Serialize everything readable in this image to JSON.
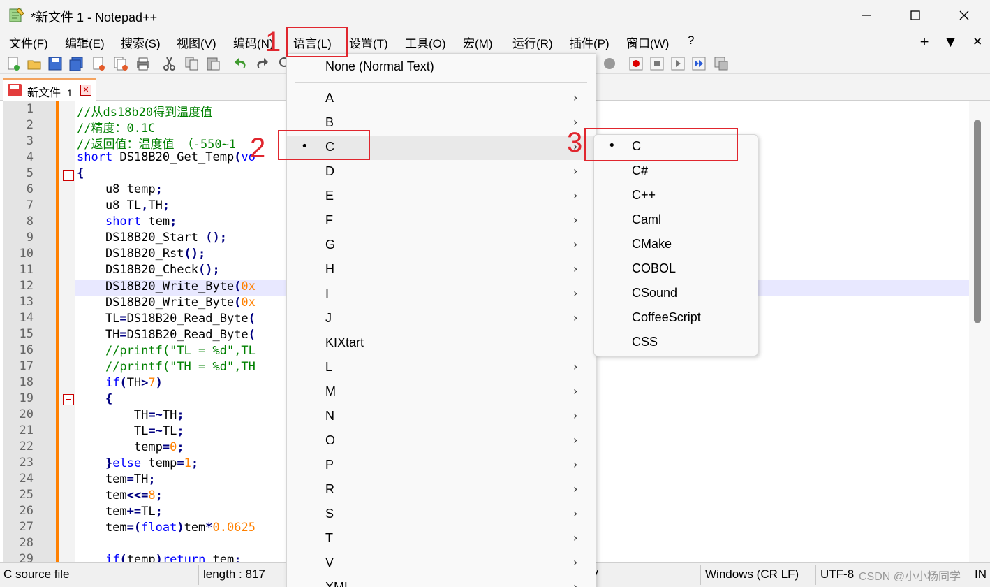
{
  "window": {
    "title": "*新文件 1 - Notepad++",
    "minimize": "—",
    "maximize": "☐",
    "close": "✕"
  },
  "menubar": {
    "items": [
      "文件(F)",
      "编辑(E)",
      "搜索(S)",
      "视图(V)",
      "编码(N)",
      "语言(L)",
      "设置(T)",
      "工具(O)",
      "宏(M)",
      "运行(R)",
      "插件(P)",
      "窗口(W)",
      "?"
    ],
    "right": [
      "+",
      "▼",
      "✕"
    ]
  },
  "tab": {
    "label": "新文件",
    "index": "1",
    "close": "✕"
  },
  "editor": {
    "line_numbers": [
      "1",
      "2",
      "3",
      "4",
      "5",
      "6",
      "7",
      "8",
      "9",
      "10",
      "11",
      "12",
      "13",
      "14",
      "15",
      "16",
      "17",
      "18",
      "19",
      "20",
      "21",
      "22",
      "23",
      "24",
      "25",
      "26",
      "27",
      "28",
      "29"
    ]
  },
  "lang_menu": {
    "top_item": "None (Normal Text)",
    "items": [
      "A",
      "B",
      "C",
      "D",
      "E",
      "F",
      "G",
      "H",
      "I",
      "J",
      "KIXtart",
      "L",
      "M",
      "N",
      "O",
      "P",
      "R",
      "S",
      "T",
      "V",
      "XML"
    ],
    "selected": "C",
    "arrow": "›",
    "bullet": "•"
  },
  "sub_menu": {
    "items": [
      "C",
      "C#",
      "C++",
      "Caml",
      "CMake",
      "COBOL",
      "CSound",
      "CoffeeScript",
      "CSS"
    ],
    "selected": "C"
  },
  "annotations": {
    "step1": "1",
    "step2": "2",
    "step3": "3"
  },
  "statusbar": {
    "file_type": "C source file",
    "length": "length : 817",
    "eol": "Windows (CR LF)",
    "encoding": "UTF-8",
    "ins": "IN",
    "misc": "V"
  },
  "watermark": "CSDN @小小杨同学",
  "colors": {
    "accent_red": "#e0262e",
    "margin_orange": "#ff8000",
    "comment_green": "#008000",
    "keyword_blue": "#0000ff"
  }
}
